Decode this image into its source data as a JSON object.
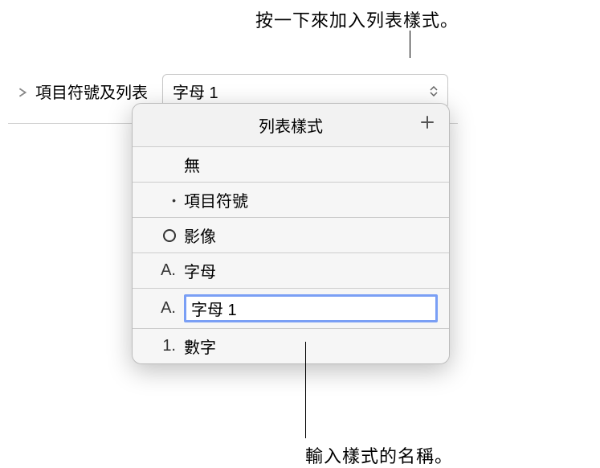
{
  "annotations": {
    "top": "按一下來加入列表樣式。",
    "bottom": "輸入樣式的名稱。"
  },
  "toolbar": {
    "label": "項目符號及列表",
    "selected_value": "字母 1"
  },
  "popover": {
    "title": "列表樣式"
  },
  "list_items": [
    {
      "marker": "",
      "label": "無",
      "editing": false
    },
    {
      "marker": "•",
      "label": "項目符號",
      "editing": false
    },
    {
      "marker": "circle",
      "label": "影像",
      "editing": false
    },
    {
      "marker": "A.",
      "label": "字母",
      "editing": false
    },
    {
      "marker": "A.",
      "label": "字母 1",
      "editing": true
    },
    {
      "marker": "1.",
      "label": "數字",
      "editing": false
    }
  ]
}
